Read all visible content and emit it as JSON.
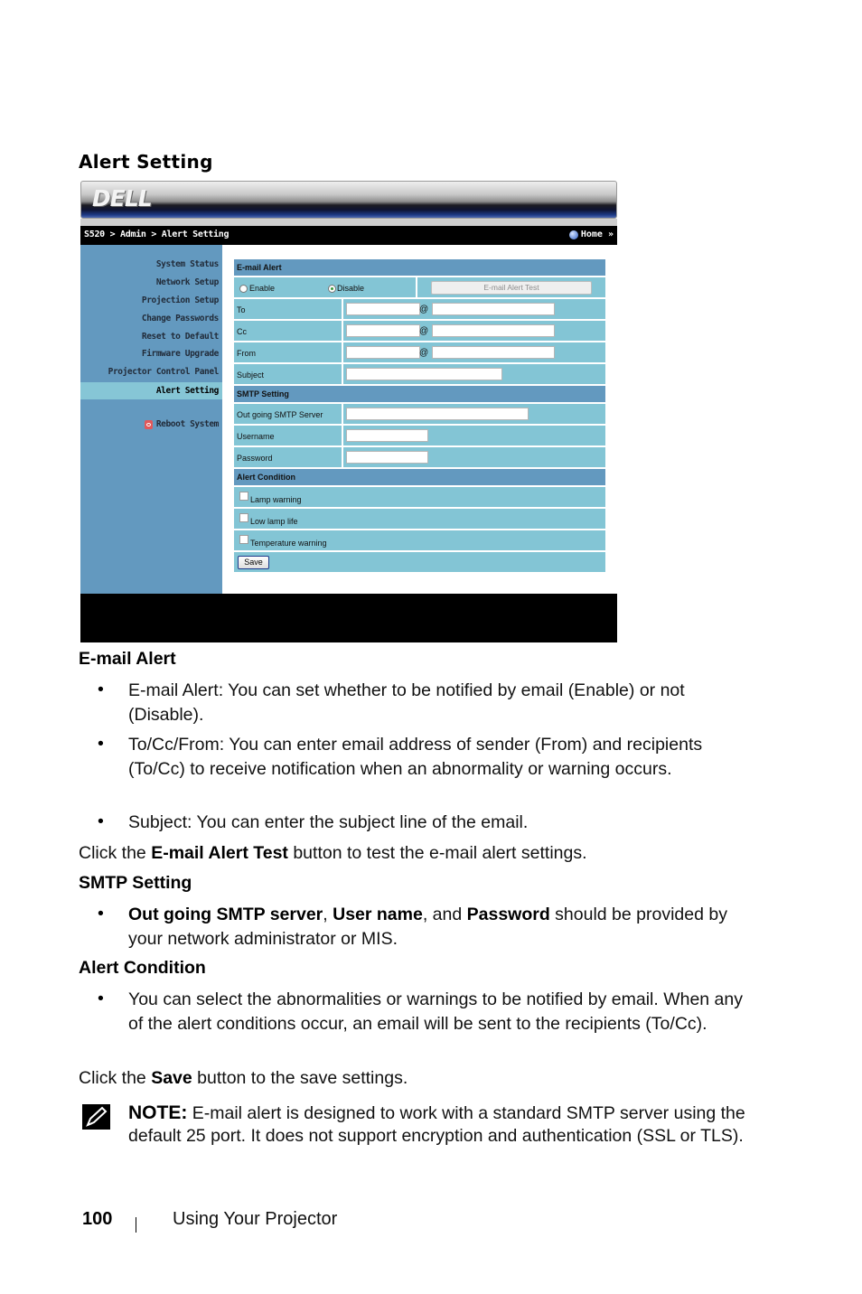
{
  "section_title": "Alert Setting",
  "ui": {
    "logo": "DELL",
    "breadcrumb": "S520 > Admin > Alert Setting",
    "home_link": "Home »",
    "sidebar": {
      "items": [
        {
          "label": "System Status"
        },
        {
          "label": "Network Setup"
        },
        {
          "label": "Projection Setup"
        },
        {
          "label": "Change Passwords"
        },
        {
          "label": "Reset to Default"
        },
        {
          "label": "Firmware Upgrade"
        },
        {
          "label": "Projector Control Panel"
        },
        {
          "label": "Alert Setting",
          "active": true
        }
      ],
      "reboot": "Reboot System"
    },
    "form": {
      "email_alert_header": "E-mail Alert",
      "enable_label": "Enable",
      "disable_label": "Disable",
      "selected": "Disable",
      "test_button": "E-mail Alert Test",
      "to_label": "To",
      "cc_label": "Cc",
      "from_label": "From",
      "subject_label": "Subject",
      "at_symbol": "@",
      "to_user": "",
      "to_domain": "",
      "cc_user": "",
      "cc_domain": "",
      "from_user": "",
      "from_domain": "",
      "subject_value": "",
      "smtp_header": "SMTP Setting",
      "smtp_server_label": "Out going SMTP Server",
      "smtp_server_value": "",
      "username_label": "Username",
      "username_value": "",
      "password_label": "Password",
      "password_value": "",
      "condition_header": "Alert Condition",
      "conditions": [
        {
          "label": "Lamp warning",
          "checked": false
        },
        {
          "label": "Low lamp life",
          "checked": false
        },
        {
          "label": "Temperature warning",
          "checked": false
        }
      ],
      "save_button": "Save"
    }
  },
  "doc": {
    "email_heading": "E-mail Alert",
    "email_bullets": [
      "E-mail Alert: You can set whether to be notified by email (Enable) or not (Disable).",
      "To/Cc/From: You can enter email address of sender (From) and recipients (To/Cc) to receive notification when an abnormality or warning occurs.",
      "Subject: You can enter the subject line of the email."
    ],
    "test_line": {
      "pre": "Click the ",
      "bold": "E-mail Alert Test",
      "post": " button to test the e-mail alert settings."
    },
    "smtp_heading": "SMTP Setting",
    "smtp_bullet": {
      "b1": "Out going SMTP server",
      "t1": ", ",
      "b2": "User name",
      "t2": ", and ",
      "b3": "Password",
      "t3": " should be provided by your network administrator or MIS."
    },
    "condition_heading": "Alert Condition",
    "condition_bullet": "You can select the abnormalities or warnings to be notified by email. When any of the alert conditions occur, an email will be sent to the recipients (To/Cc).",
    "save_line": {
      "pre": "Click the ",
      "bold": "Save",
      "post": " button to the save settings."
    },
    "note": {
      "label": "NOTE:",
      "text": " E-mail alert is designed to work with a standard SMTP server using the default 25 port. It does not support encryption and authentication (SSL or TLS)."
    },
    "bullet_char": "•"
  },
  "footer": {
    "page_number": "100",
    "chapter": "Using Your Projector"
  }
}
